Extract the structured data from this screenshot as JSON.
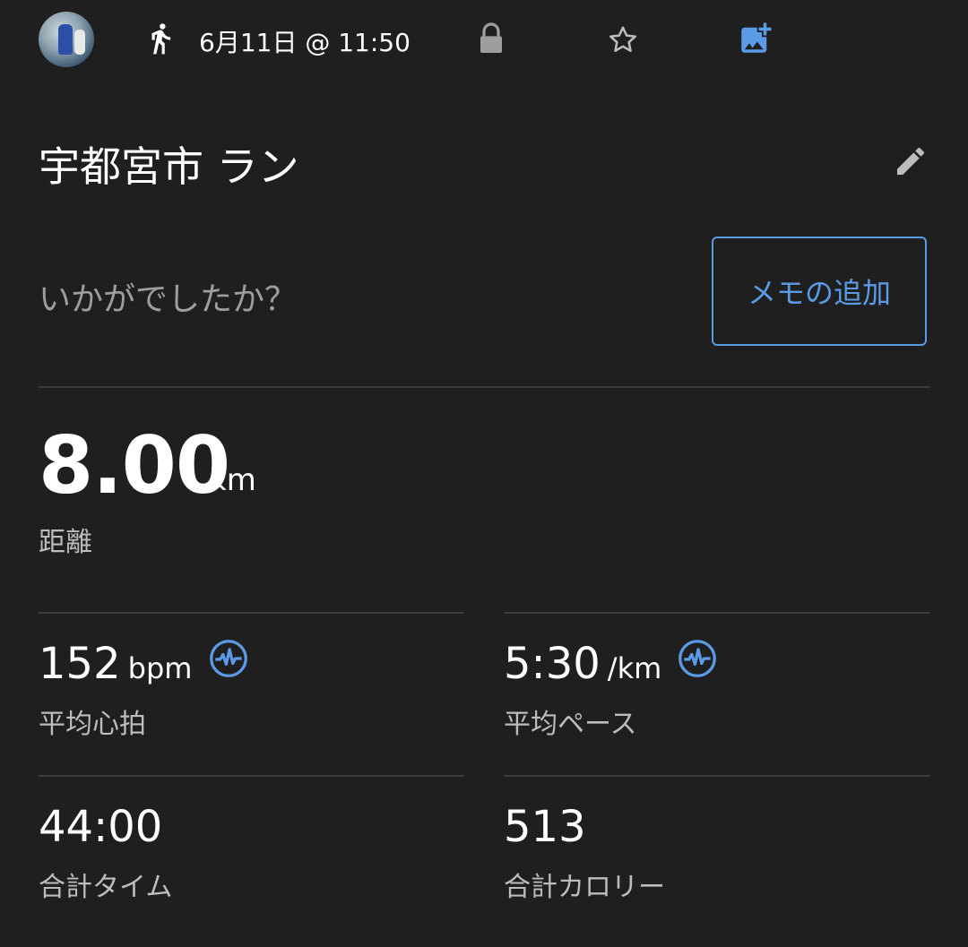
{
  "header": {
    "activity_icon": "running-icon",
    "date_time": "6月11日 @ 11:50",
    "privacy_icon": "lock-icon",
    "favorite_icon": "star-icon",
    "add_photo_icon": "add-photo-icon"
  },
  "activity": {
    "title": "宇都宮市 ラン",
    "edit_icon": "pencil-icon",
    "prompt": "いかがでしたか？",
    "memo_button": "メモの追加"
  },
  "distance": {
    "value": "8.00",
    "unit": "km",
    "label": "距離"
  },
  "stats": [
    {
      "value": "152",
      "unit": "bpm",
      "label": "平均心拍",
      "badge_icon": "pulse-icon"
    },
    {
      "value": "5:30",
      "unit": "/km",
      "label": "平均ペース",
      "badge_icon": "pulse-icon"
    },
    {
      "value": "44:00",
      "unit": "",
      "label": "合計タイム"
    },
    {
      "value": "513",
      "unit": "",
      "label": "合計カロリー"
    }
  ],
  "colors": {
    "background": "#1f1f1f",
    "accent": "#5b9be6",
    "divider": "#3c3c3c",
    "secondary_text": "#bdbdbd"
  }
}
